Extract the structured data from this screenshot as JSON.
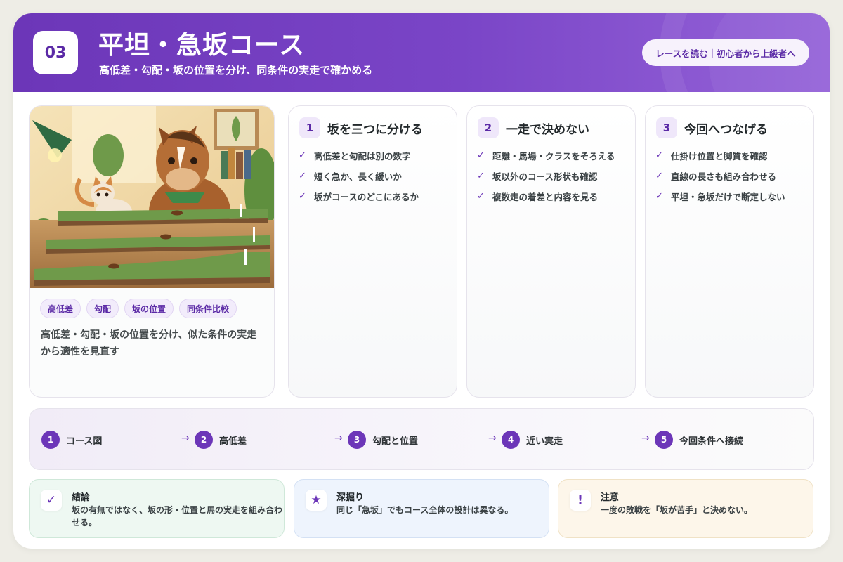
{
  "header": {
    "number": "03",
    "title": "平坦・急坂コース",
    "subtitle": "高低差・勾配・坂の位置を分け、同条件の実走で確かめる",
    "pill_button": "レースを読む｜初心者から上級者へ"
  },
  "image_card": {
    "tags": [
      "高低差",
      "勾配",
      "坂の位置",
      "同条件比較"
    ],
    "caption": "高低差・勾配・坂の位置を分け、似た条件の実走から適性を見直す"
  },
  "steps": [
    {
      "num": "1",
      "title": "坂を三つに分ける",
      "items": [
        "高低差と勾配は別の数字",
        "短く急か、長く緩いか",
        "坂がコースのどこにあるか"
      ]
    },
    {
      "num": "2",
      "title": "一走で決めない",
      "items": [
        "距離・馬場・クラスをそろえる",
        "坂以外のコース形状も確認",
        "複数走の着差と内容を見る"
      ]
    },
    {
      "num": "3",
      "title": "今回へつなげる",
      "items": [
        "仕掛け位置と脚質を確認",
        "直線の長さも組み合わせる",
        "平坦・急坂だけで断定しない"
      ]
    }
  ],
  "check_mark": "✓",
  "flow": {
    "arrow": "→",
    "steps": [
      {
        "num": "1",
        "label": "コース図"
      },
      {
        "num": "2",
        "label": "高低差"
      },
      {
        "num": "3",
        "label": "勾配と位置"
      },
      {
        "num": "4",
        "label": "近い実走"
      },
      {
        "num": "5",
        "label": "今回条件へ接続"
      }
    ]
  },
  "notes": [
    {
      "icon": "✓",
      "icon_name": "check-icon",
      "title": "結論",
      "text": "坂の有無ではなく、坂の形・位置と馬の実走を組み合わせる。",
      "tone": "#eef8f2"
    },
    {
      "icon": "★",
      "icon_name": "star-icon",
      "title": "深掘り",
      "text": "同じ「急坂」でもコース全体の設計は異なる。",
      "tone": "#eef4fd"
    },
    {
      "icon": "!",
      "icon_name": "exclamation-icon",
      "title": "注意",
      "text": "一度の敗戦を「坂が苦手」と決めない。",
      "tone": "#fdf6ea"
    }
  ],
  "colors": {
    "accent": "#6c36b8",
    "accent_light": "#efe7fa"
  }
}
